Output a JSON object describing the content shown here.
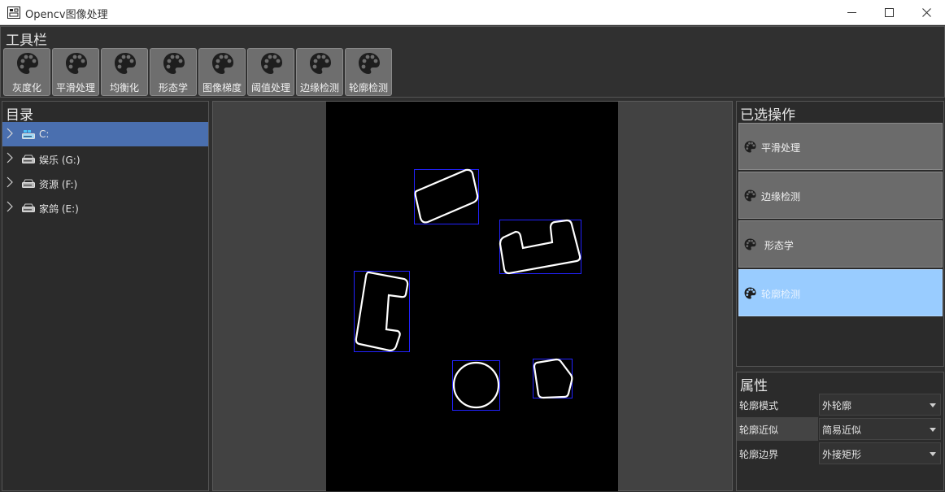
{
  "window": {
    "title": "Opencv图像处理"
  },
  "toolbar": {
    "title": "工具栏",
    "buttons": [
      "灰度化",
      "平滑处理",
      "均衡化",
      "形态学",
      "图像梯度",
      "阈值处理",
      "边缘检测",
      "轮廓检测"
    ]
  },
  "directory": {
    "title": "目录",
    "items": [
      {
        "label": "C:",
        "selected": true
      },
      {
        "label": "娱乐 (G:)",
        "selected": false
      },
      {
        "label": "资源 (F:)",
        "selected": false
      },
      {
        "label": "家鸽 (E:)",
        "selected": false
      }
    ]
  },
  "operations": {
    "title": "已选操作",
    "items": [
      {
        "label": "平滑处理",
        "active": false
      },
      {
        "label": "边缘检测",
        "active": false
      },
      {
        "label": " 形态学",
        "active": false
      },
      {
        "label": "轮廓检测",
        "active": true
      }
    ]
  },
  "properties": {
    "title": "属性",
    "rows": [
      {
        "name": "轮廓模式",
        "value": "外轮廓"
      },
      {
        "name": "轮廓近似",
        "value": "简易近似"
      },
      {
        "name": "轮廓边界",
        "value": "外接矩形"
      }
    ]
  },
  "colors": {
    "background": "#2f2f2f",
    "selection": "#4a6faf",
    "active_operation": "#99ccff",
    "bounding_box": "#2222ff",
    "contour": "#ffffff"
  }
}
